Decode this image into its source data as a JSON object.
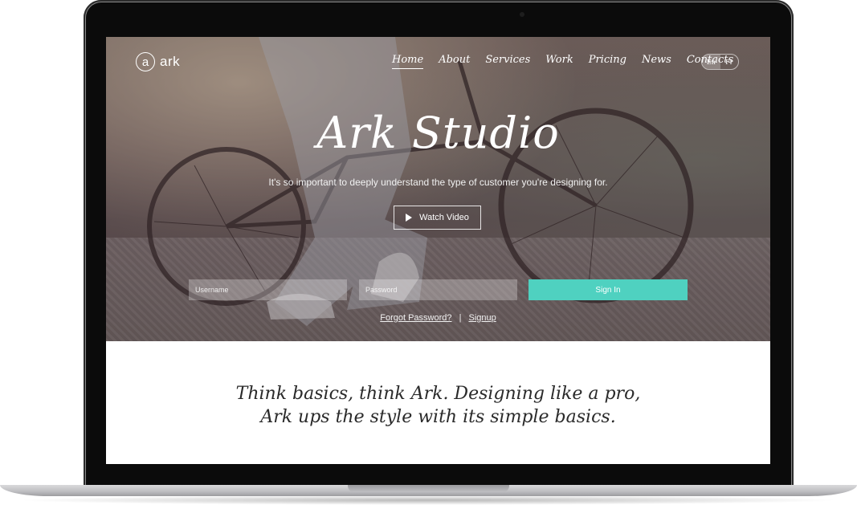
{
  "brand": {
    "logo_letter": "a",
    "name": "ark"
  },
  "nav": {
    "items": [
      "Home",
      "About",
      "Services",
      "Work",
      "Pricing",
      "News",
      "Contacts"
    ],
    "active": "Home"
  },
  "lang": {
    "options": [
      "En",
      "Fr"
    ],
    "selected": "En"
  },
  "hero": {
    "title": "Ark Studio",
    "subtitle": "It's so important to deeply understand the type of customer you're designing for.",
    "watch_label": "Watch Video"
  },
  "login": {
    "username_placeholder": "Username",
    "password_placeholder": "Password",
    "signin_label": "Sign In",
    "forgot_label": "Forgot Password?",
    "separator": "|",
    "signup_label": "Signup"
  },
  "tagline": {
    "line1": "Think basics, think Ark. Designing like a pro,",
    "line2": "Ark ups the style with its simple basics."
  },
  "colors": {
    "accent": "#4fd1c0"
  }
}
